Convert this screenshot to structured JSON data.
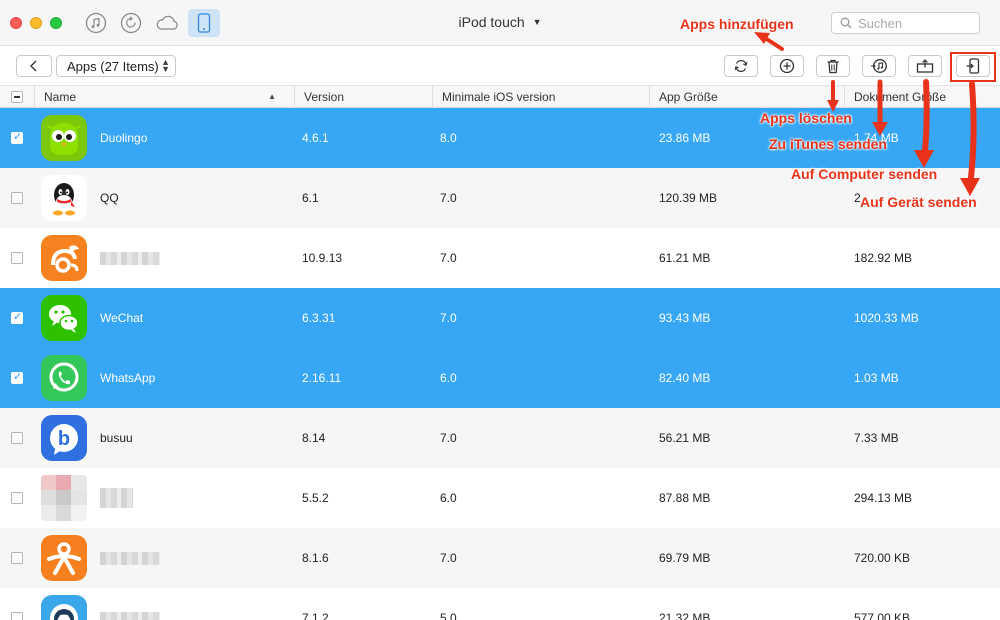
{
  "window": {
    "title": "iPod touch",
    "search_placeholder": "Suchen"
  },
  "nav_icons": [
    "music-icon",
    "restore-icon",
    "cloud-icon",
    "device-icon"
  ],
  "toolbar": {
    "category": "Apps (27 Items)",
    "buttons": [
      "refresh-icon",
      "add-icon",
      "trash-icon",
      "itunes-send-icon",
      "computer-send-icon",
      "device-send-icon"
    ]
  },
  "table": {
    "headers": {
      "name": "Name",
      "version": "Version",
      "min_ios": "Minimale iOS version",
      "app_size": "App Größe",
      "doc_size": "Dokument Größe"
    },
    "rows": [
      {
        "name": "Duolingo",
        "version": "4.6.1",
        "min_ios": "8.0",
        "app_size": "23.86 MB",
        "doc_size": "1.74 MB",
        "selected": true,
        "icon": "duolingo-icon"
      },
      {
        "name": "QQ",
        "version": "6.1",
        "min_ios": "7.0",
        "app_size": "120.39 MB",
        "doc_size": "2",
        "selected": false,
        "icon": "qq-icon"
      },
      {
        "name": "",
        "version": "10.9.13",
        "min_ios": "7.0",
        "app_size": "61.21 MB",
        "doc_size": "182.92 MB",
        "selected": false,
        "icon": "uc-browser-icon"
      },
      {
        "name": "WeChat",
        "version": "6.3.31",
        "min_ios": "7.0",
        "app_size": "93.43 MB",
        "doc_size": "1020.33 MB",
        "selected": true,
        "icon": "wechat-icon"
      },
      {
        "name": "WhatsApp",
        "version": "2.16.11",
        "min_ios": "6.0",
        "app_size": "82.40 MB",
        "doc_size": "1.03 MB",
        "selected": true,
        "icon": "whatsapp-icon"
      },
      {
        "name": "busuu",
        "version": "8.14",
        "min_ios": "7.0",
        "app_size": "56.21 MB",
        "doc_size": "7.33 MB",
        "selected": false,
        "icon": "busuu-icon"
      },
      {
        "name": "",
        "version": "5.5.2",
        "min_ios": "6.0",
        "app_size": "87.88 MB",
        "doc_size": "294.13 MB",
        "selected": false,
        "icon": "blurred-app-icon"
      },
      {
        "name": "",
        "version": "8.1.6",
        "min_ios": "7.0",
        "app_size": "69.79 MB",
        "doc_size": "720.00 KB",
        "selected": false,
        "icon": "orange-person-app-icon"
      },
      {
        "name": "",
        "version": "7.1.2",
        "min_ios": "5.0",
        "app_size": "21.32 MB",
        "doc_size": "577.00 KB",
        "selected": false,
        "icon": "blue-penguin-app-icon"
      }
    ]
  },
  "annotations": {
    "add": "Apps hinzufügen",
    "delete": "Apps löschen",
    "to_itunes": "Zu iTunes senden",
    "to_computer": "Auf Computer senden",
    "to_device": "Auf Gerät senden"
  },
  "colors": {
    "selected_row": "#36a6f5",
    "annotation": "#e8331a"
  }
}
